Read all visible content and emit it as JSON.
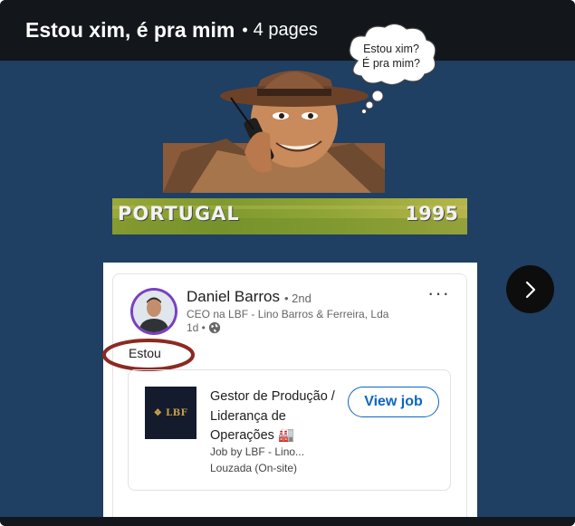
{
  "document": {
    "title": "Estou xim, é pra mim",
    "separator": "•",
    "page_count": "4 pages"
  },
  "meme": {
    "thought_line1": "Estou xim?",
    "thought_line2": "É pra mim?",
    "banner_left": "PORTUGAL",
    "banner_right": "1995"
  },
  "post": {
    "author_name": "Daniel Barros",
    "degree": "• 2nd",
    "headline": "CEO na LBF - Lino Barros & Ferreira, Lda",
    "time": "1d •",
    "visibility_icon": "globe-icon",
    "more_icon": "more-horizontal-icon",
    "more_label": "···",
    "text": "Estou",
    "annotation_color": "#8b2a22"
  },
  "job": {
    "logo_text": "❖ LBF",
    "title": "Gestor de Produção / Liderança de Operações 🏭",
    "byline": "Job by LBF - Lino...",
    "location": "Louzada (On-site)",
    "cta": "View job",
    "cta_color": "#0a66c2"
  },
  "nav": {
    "next_icon": "chevron-right-icon"
  },
  "colors": {
    "background": "#1f3f63",
    "topbar": "#13161a"
  }
}
